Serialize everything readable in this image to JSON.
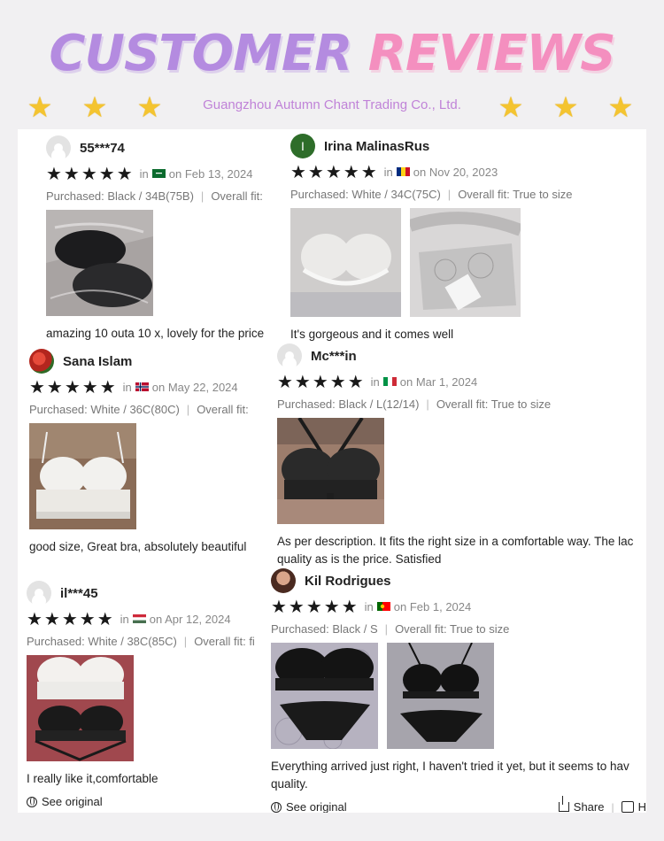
{
  "header": {
    "title_part1": "CUSTOMER",
    "title_part2": "REVIEWS",
    "company": "Guangzhou Autumn Chant Trading Co., Ltd.",
    "star_icon": "star-icon"
  },
  "labels": {
    "in": "in",
    "purchased_prefix": "Purchased: ",
    "overall_fit_prefix": "Overall fit: ",
    "see_original": "See original",
    "share": "Share",
    "helpful_fragment": "H"
  },
  "reviews": [
    {
      "name": "55***74",
      "stars": "★★★★★",
      "country_flag": "saudi-arabia-flag",
      "date": "on Feb 13, 2024",
      "purchased": "Black / 34B(75B)",
      "fit": "",
      "comment": "amazing 10 outa 10 x, lovely for the price"
    },
    {
      "name": "Irina MalinasRus",
      "avatar_letter": "I",
      "stars": "★★★★★",
      "country_flag": "romania-flag",
      "date": "on Nov 20, 2023",
      "purchased": "White / 34C(75C)",
      "fit": "True to size",
      "comment": "It's gorgeous and it comes well"
    },
    {
      "name": "Sana Islam",
      "stars": "★★★★★",
      "country_flag": "norway-flag",
      "date": "on May 22, 2024",
      "purchased": "White / 36C(80C)",
      "fit": "",
      "comment": "good size, Great bra, absolutely beautiful"
    },
    {
      "name": "Mc***in",
      "stars": "★★★★★",
      "country_flag": "italy-flag",
      "date": "on Mar 1, 2024",
      "purchased": "Black / L(12/14)",
      "fit": "True to size",
      "comment_line1": "As per description. It fits the right size in a comfortable way. The lac",
      "comment_line2": "quality as is the price. Satisfied"
    },
    {
      "name": "il***45",
      "stars": "★★★★★",
      "country_flag": "hungary-flag",
      "date": "on Apr 12, 2024",
      "purchased": "White / 38C(85C)",
      "fit": "fi",
      "comment": "I really like it,comfortable"
    },
    {
      "name": "Kil Rodrigues",
      "stars": "★★★★★",
      "country_flag": "portugal-flag",
      "date": "on Feb 1, 2024",
      "purchased": "Black / S",
      "fit": "True to size",
      "comment_line1": "Everything arrived just right, I haven't tried it yet, but it seems to hav",
      "comment_line2": "quality."
    }
  ],
  "colors": {
    "title_purple": "#b48be0",
    "title_pink": "#f48fbf",
    "company_text": "#c083d8",
    "star_gold": "#f4c430"
  }
}
